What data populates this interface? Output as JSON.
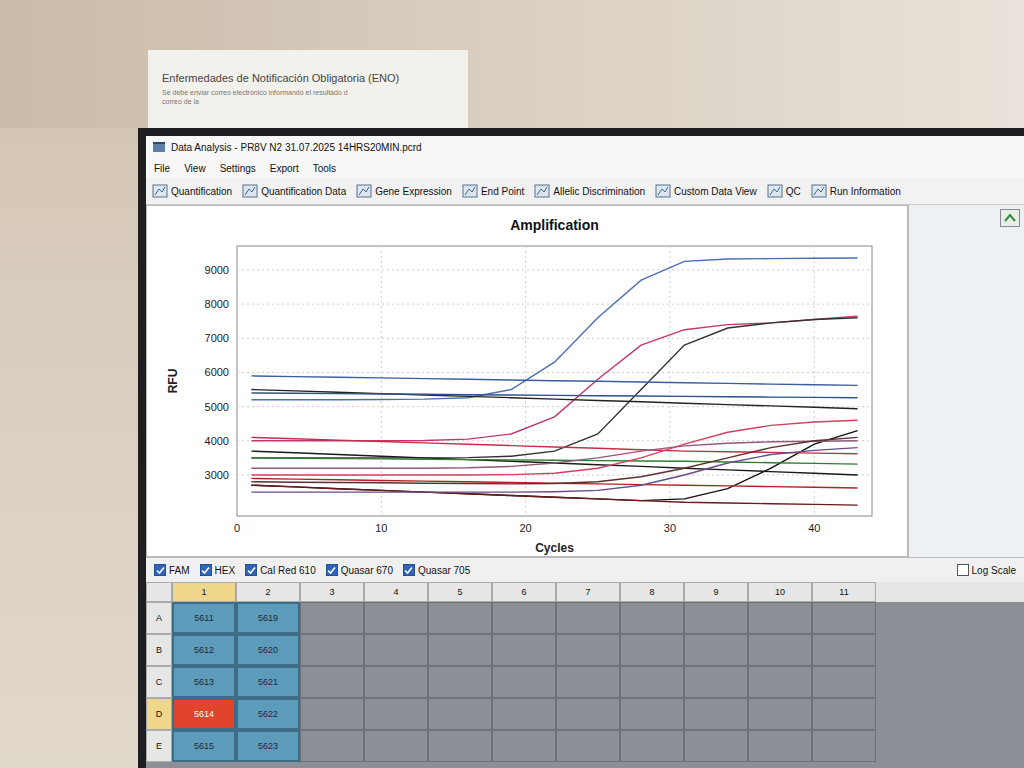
{
  "wall_note": {
    "title": "Enfermedades de Notificación Obligatoria (ENO)",
    "lines": [
      "Se debe enviar correo electrónico informando el resultado d",
      "correo de la"
    ]
  },
  "window": {
    "title": "Data Analysis - PR8V N2 31.07.2025 14HRS20MIN.pcrd"
  },
  "menu": [
    "File",
    "View",
    "Settings",
    "Export",
    "Tools"
  ],
  "toolbar": [
    "Quantification",
    "Quantification Data",
    "Gene Expression",
    "End Point",
    "Allelic Discrimination",
    "Custom Data View",
    "QC",
    "Run Information"
  ],
  "chart": {
    "title": "Amplification",
    "y_label": "RFU",
    "x_label": "Cycles",
    "y_ticks": [
      "3000",
      "4000",
      "5000",
      "6000",
      "7000",
      "8000",
      "9000"
    ],
    "x_ticks": [
      "0",
      "10",
      "20",
      "30",
      "40"
    ],
    "cycles": [
      1,
      4,
      7,
      10,
      13,
      16,
      19,
      22,
      25,
      28,
      31,
      34,
      37,
      40,
      43
    ],
    "series": [
      {
        "color": "#4a6fb5",
        "values": [
          5200,
          5200,
          5200,
          5210,
          5220,
          5260,
          5500,
          6300,
          7600,
          8700,
          9250,
          9320,
          9330,
          9340,
          9350
        ]
      },
      {
        "color": "#c2366f",
        "values": [
          4000,
          4000,
          4000,
          4000,
          4010,
          4050,
          4200,
          4700,
          5800,
          6800,
          7250,
          7400,
          7450,
          7550,
          7650
        ]
      },
      {
        "color": "#333333",
        "values": [
          3500,
          3500,
          3500,
          3500,
          3500,
          3510,
          3550,
          3700,
          4200,
          5500,
          6800,
          7300,
          7450,
          7550,
          7600
        ]
      },
      {
        "color": "#111111",
        "values": [
          2700,
          2650,
          2600,
          2550,
          2500,
          2450,
          2400,
          2350,
          2300,
          2250,
          2300,
          2600,
          3200,
          3900,
          4300
        ]
      },
      {
        "color": "#3b5da0",
        "values": [
          5900,
          5880,
          5860,
          5840,
          5820,
          5800,
          5780,
          5760,
          5740,
          5720,
          5700,
          5680,
          5660,
          5640,
          5620
        ]
      },
      {
        "color": "#222222",
        "values": [
          5500,
          5460,
          5420,
          5380,
          5340,
          5300,
          5260,
          5220,
          5180,
          5140,
          5100,
          5060,
          5020,
          4980,
          4940
        ]
      },
      {
        "color": "#2f4f8f",
        "values": [
          5400,
          5390,
          5380,
          5370,
          5360,
          5350,
          5340,
          5330,
          5320,
          5310,
          5300,
          5290,
          5280,
          5270,
          5260
        ]
      },
      {
        "color": "#c0304a",
        "values": [
          4100,
          4060,
          4020,
          3980,
          3940,
          3900,
          3860,
          3820,
          3780,
          3740,
          3700,
          3680,
          3660,
          3640,
          3620
        ]
      },
      {
        "color": "#1a1a1a",
        "values": [
          3700,
          3650,
          3600,
          3550,
          3500,
          3450,
          3400,
          3350,
          3300,
          3250,
          3200,
          3150,
          3100,
          3050,
          3000
        ]
      },
      {
        "color": "#2e7d32",
        "values": [
          3500,
          3490,
          3480,
          3470,
          3460,
          3450,
          3440,
          3430,
          3420,
          3410,
          3400,
          3380,
          3360,
          3340,
          3320
        ]
      },
      {
        "color": "#b22222",
        "values": [
          2900,
          2880,
          2860,
          2840,
          2820,
          2800,
          2780,
          2760,
          2740,
          2720,
          2700,
          2680,
          2660,
          2640,
          2620
        ]
      },
      {
        "color": "#6b1a1a",
        "values": [
          2700,
          2650,
          2600,
          2550,
          2500,
          2450,
          2400,
          2350,
          2300,
          2250,
          2200,
          2180,
          2160,
          2140,
          2120
        ]
      },
      {
        "color": "#8e5a7a",
        "values": [
          3200,
          3200,
          3200,
          3200,
          3200,
          3210,
          3250,
          3350,
          3500,
          3700,
          3850,
          3930,
          3970,
          3990,
          4000
        ]
      },
      {
        "color": "#d04060",
        "values": [
          3000,
          3000,
          3000,
          3000,
          3000,
          3000,
          3010,
          3050,
          3200,
          3500,
          3900,
          4250,
          4450,
          4550,
          4600
        ]
      },
      {
        "color": "#6a4a8a",
        "values": [
          2500,
          2500,
          2500,
          2500,
          2500,
          2500,
          2500,
          2510,
          2550,
          2700,
          3000,
          3350,
          3600,
          3720,
          3800
        ]
      },
      {
        "color": "#5a3030",
        "values": [
          2800,
          2790,
          2780,
          2770,
          2760,
          2750,
          2740,
          2750,
          2800,
          2950,
          3200,
          3500,
          3800,
          4000,
          4100
        ]
      }
    ]
  },
  "fluorophores": [
    {
      "label": "FAM",
      "checked": true
    },
    {
      "label": "HEX",
      "checked": true
    },
    {
      "label": "Cal Red 610",
      "checked": true
    },
    {
      "label": "Quasar 670",
      "checked": true
    },
    {
      "label": "Quasar 705",
      "checked": true
    }
  ],
  "log_scale": {
    "label": "Log Scale",
    "checked": false
  },
  "plate": {
    "columns": [
      {
        "label": "1",
        "selected": true
      },
      {
        "label": "2",
        "selected": false
      },
      {
        "label": "3",
        "selected": false
      },
      {
        "label": "4",
        "selected": false
      },
      {
        "label": "5",
        "selected": false
      },
      {
        "label": "6",
        "selected": false
      },
      {
        "label": "7",
        "selected": false
      },
      {
        "label": "8",
        "selected": false
      },
      {
        "label": "9",
        "selected": false
      },
      {
        "label": "10",
        "selected": false
      },
      {
        "label": "11",
        "selected": false
      }
    ],
    "rows": [
      {
        "label": "A",
        "selected": false,
        "wells": [
          {
            "id": "5611",
            "selected": false
          },
          {
            "id": "5619",
            "selected": false
          }
        ]
      },
      {
        "label": "B",
        "selected": false,
        "wells": [
          {
            "id": "5612",
            "selected": false
          },
          {
            "id": "5620",
            "selected": false
          }
        ]
      },
      {
        "label": "C",
        "selected": false,
        "wells": [
          {
            "id": "5613",
            "selected": false
          },
          {
            "id": "5621",
            "selected": false
          }
        ]
      },
      {
        "label": "D",
        "selected": true,
        "wells": [
          {
            "id": "5614",
            "selected": true
          },
          {
            "id": "5622",
            "selected": false
          }
        ]
      },
      {
        "label": "E",
        "selected": false,
        "wells": [
          {
            "id": "5615",
            "selected": false
          },
          {
            "id": "5623",
            "selected": false
          }
        ]
      }
    ]
  }
}
